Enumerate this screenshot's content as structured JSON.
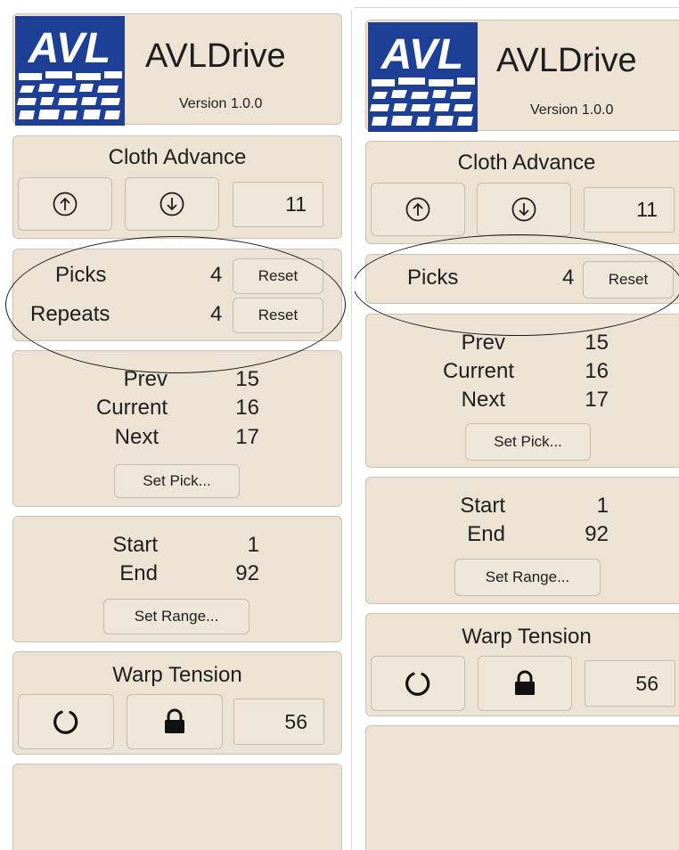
{
  "app": {
    "title": "AVLDrive",
    "version": "Version 1.0.0",
    "logo_text": "AVL"
  },
  "cloth_advance": {
    "title": "Cloth Advance",
    "value": "11",
    "up_icon": "arrow-up-circle-icon",
    "down_icon": "arrow-down-circle-icon"
  },
  "counters": {
    "picks_label": "Picks",
    "picks_value": "4",
    "repeats_label": "Repeats",
    "repeats_value": "4",
    "reset_label": "Reset"
  },
  "pick": {
    "prev_label": "Prev",
    "prev_value": "15",
    "current_label": "Current",
    "current_value": "16",
    "next_label": "Next",
    "next_value": "17",
    "set_pick_label": "Set Pick..."
  },
  "range": {
    "start_label": "Start",
    "start_value": "1",
    "end_label": "End",
    "end_value": "92",
    "set_range_label": "Set Range..."
  },
  "warp_tension": {
    "title": "Warp Tension",
    "value": "56",
    "refresh_icon": "refresh-icon",
    "lock_icon": "lock-icon"
  },
  "colors": {
    "panel_bg": "#ede3d5",
    "button_bg": "#efe6da",
    "logo_blue": "#1d3f95",
    "border": "#cdc2b4"
  }
}
